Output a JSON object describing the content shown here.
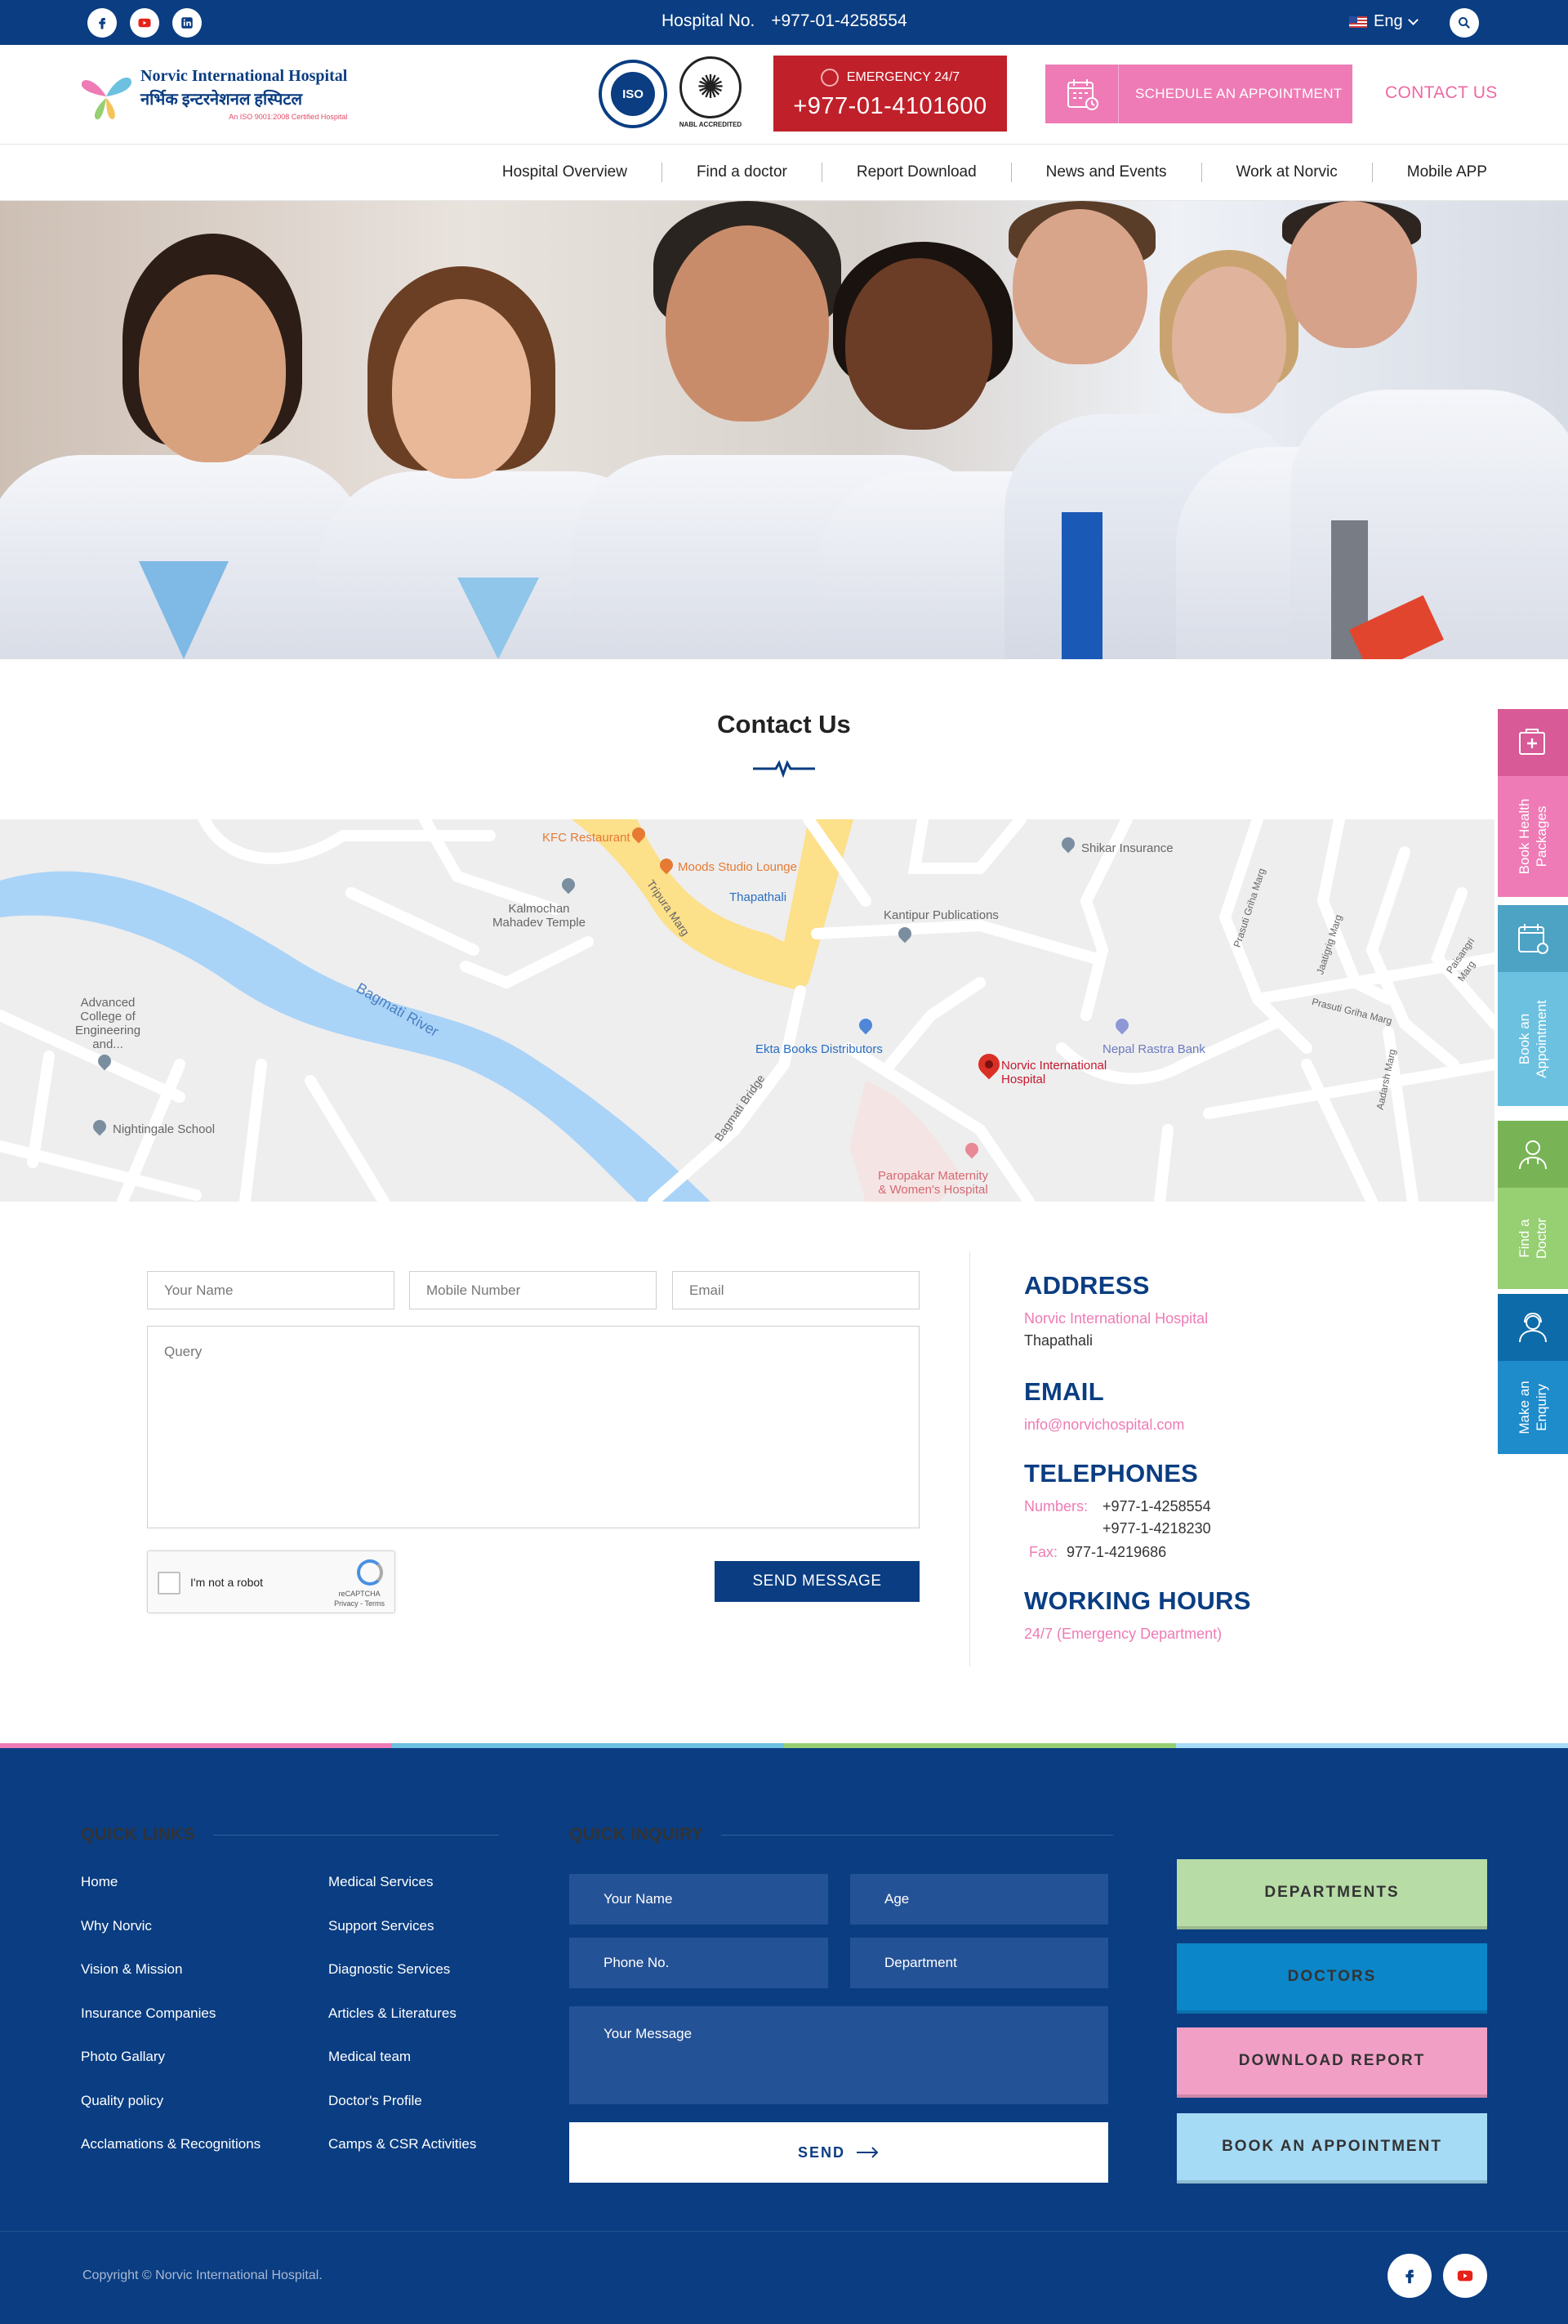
{
  "topbar": {
    "hospital_no_label": "Hospital No.",
    "hospital_no": "+977-01-4258554",
    "language": "Eng"
  },
  "header": {
    "logo_line1": "Norvic International Hospital",
    "logo_line2": "नर्भिक इन्टरनेशनल हस्पिटल",
    "logo_line3": "An ISO 9001:2008 Certified Hospital",
    "iso_text": "ISO",
    "nabl_caption": "NABL ACCREDITED",
    "emergency_label": "EMERGENCY 24/7",
    "emergency_phone": "+977-01-4101600",
    "schedule_label": "SCHEDULE AN APPOINTMENT",
    "contact_label": "CONTACT US"
  },
  "nav": {
    "items": [
      "Hospital Overview",
      "Find a doctor",
      "Report Download",
      "News and Events",
      "Work at Norvic",
      "Mobile APP"
    ]
  },
  "contact": {
    "title": "Contact Us"
  },
  "map": {
    "labels": {
      "kfc": "KFC Restaurant",
      "moods": "Moods Studio Lounge",
      "thapathali": "Thapathali",
      "kalmochan": "Kalmochan\nMahadev Temple",
      "tripura": "Tripura Marg",
      "kantipur": "Kantipur Publications",
      "shikar": "Shikar Insurance",
      "bagmati_river": "Bagmati River",
      "advanced": "Advanced\nCollege of\nEngineering\nand...",
      "ekta": "Ekta Books Distributors",
      "norvic": "Norvic International\nHospital",
      "nepal_rastra": "Nepal Rastra Bank",
      "bagmati_bridge": "Bagmati Bridge",
      "nightingale": "Nightingale School",
      "paropakar": "Paropakar Maternity\n& Women's Hospital",
      "prasuti1": "Prasuti Griha Marg",
      "prasuti2": "Prasuti Griha Marg",
      "jaatigrig": "Jaatigrig Marg",
      "paisangri": "Paisangri Marg",
      "aadarsh": "Aadarsh Marg"
    }
  },
  "form": {
    "name_placeholder": "Your Name",
    "mobile_placeholder": "Mobile Number",
    "email_placeholder": "Email",
    "query_placeholder": "Query",
    "captcha_label": "I'm not a robot",
    "captcha_brand": "reCAPTCHA",
    "captcha_links": "Privacy - Terms",
    "send_label": "SEND MESSAGE"
  },
  "info": {
    "address_title": "ADDRESS",
    "address_line1": "Norvic International Hospital",
    "address_line2": "Thapathali",
    "email_title": "EMAIL",
    "email": "info@norvichospital.com",
    "telephones_title": "TELEPHONES",
    "numbers_label": "Numbers:",
    "number1": "+977-1-4258554",
    "number2": "+977-1-4218230",
    "fax_label": "Fax:",
    "fax": "977-1-4219686",
    "hours_title": "WORKING HOURS",
    "hours": "24/7 (Emergency Department)"
  },
  "sidetabs": [
    {
      "label": "Book Health\nPackages",
      "icon": "health-package-icon",
      "color_icon": "#d85a97",
      "color_label": "#ee7bb5"
    },
    {
      "label": "Book an\nAppointment",
      "icon": "calendar-icon",
      "color_icon": "#4ca3c4",
      "color_label": "#6cc1e0"
    },
    {
      "label": "Find a\nDoctor",
      "icon": "doctor-icon",
      "color_icon": "#78b455",
      "color_label": "#97cf73"
    },
    {
      "label": "Make an\nEnquiry",
      "icon": "enquiry-icon",
      "color_icon": "#0d6ba9",
      "color_label": "#1e8bcb"
    }
  ],
  "footer": {
    "quick_links_title": "QUICK LINKS",
    "links_col1": [
      "Home",
      "Why Norvic",
      "Vision & Mission",
      "Insurance Companies",
      "Photo Gallary",
      "Quality policy",
      "Acclamations & Recognitions"
    ],
    "links_col2": [
      "Medical Services",
      "Support Services",
      "Diagnostic Services",
      "Articles & Literatures",
      "Medical team",
      "Doctor's Profile",
      "Camps & CSR Activities"
    ],
    "quick_inquiry_title": "QUICK INQUIRY",
    "qi_name": "Your Name",
    "qi_age": "Age",
    "qi_phone": "Phone No.",
    "qi_department": "Department",
    "qi_message": "Your Message",
    "qi_send": "SEND",
    "btn_departments": "DEPARTMENTS",
    "btn_doctors": "DOCTORS",
    "btn_download": "DOWNLOAD REPORT",
    "btn_book": "BOOK AN APPOINTMENT",
    "copyright": "Copyright © Norvic International Hospital."
  },
  "colors": {
    "primary": "#0a3d82",
    "pink": "#ee7bb5",
    "emergency": "#c0202a",
    "green": "#b7dca6",
    "blue": "#0b86c9",
    "light_pink": "#f29fc6",
    "light_blue": "#a6dbf5"
  }
}
